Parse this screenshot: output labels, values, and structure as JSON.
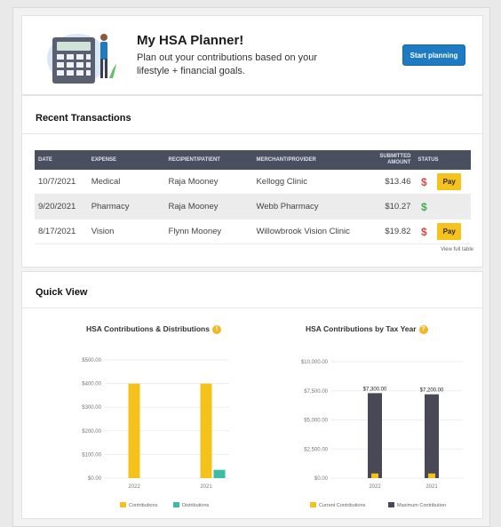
{
  "planner": {
    "title": "My HSA Planner!",
    "description": "Plan out your contributions based on your lifestyle + financial goals.",
    "button_label": "Start planning"
  },
  "transactions": {
    "title": "Recent Transactions",
    "columns": [
      "DATE",
      "EXPENSE",
      "RECIPIENT/PATIENT",
      "MERCHANT/PROVIDER",
      "SUBMITTED AMOUNT",
      "STATUS"
    ],
    "rows": [
      {
        "date": "10/7/2021",
        "expense": "Medical",
        "recipient": "Raja Mooney",
        "merchant": "Kellogg Clinic",
        "amount": "$13.46",
        "status": "$",
        "status_color": "#e04646",
        "action": "Pay"
      },
      {
        "date": "9/20/2021",
        "expense": "Pharmacy",
        "recipient": "Raja Mooney",
        "merchant": "Webb Pharmacy",
        "amount": "$10.27",
        "status": "$",
        "status_color": "#3bb04a",
        "action": ""
      },
      {
        "date": "8/17/2021",
        "expense": "Vision",
        "recipient": "Flynn Mooney",
        "merchant": "Willowbrook Vision Clinic",
        "amount": "$19.82",
        "status": "$",
        "status_color": "#e04646",
        "action": "Pay"
      }
    ],
    "view_full_label": "View full table"
  },
  "quick_view": {
    "title": "Quick View"
  },
  "colors": {
    "contributions": "#f5c21b",
    "distributions": "#3cbca3",
    "maximum": "#474a56",
    "pay_button": "#f6c21c",
    "primary_button": "#1f7bc1"
  },
  "chart_data": [
    {
      "type": "bar",
      "title": "HSA Contributions & Distributions",
      "categories": [
        "2022",
        "2021"
      ],
      "series": [
        {
          "name": "Contributions",
          "values": [
            400,
            400
          ]
        },
        {
          "name": "Distributions",
          "values": [
            0,
            35
          ]
        }
      ],
      "ylim": [
        0,
        500
      ],
      "yticks": [
        "$0.00",
        "$100.00",
        "$200.00",
        "$300.00",
        "$400.00",
        "$500.00"
      ],
      "grid": true,
      "legend": "bottom"
    },
    {
      "type": "bar",
      "title": "HSA Contributions by Tax Year",
      "categories": [
        "2022",
        "2021"
      ],
      "series": [
        {
          "name": "Current Contributions",
          "values": [
            400,
            400
          ]
        },
        {
          "name": "Maximum Contribution",
          "values": [
            7300,
            7200
          ]
        }
      ],
      "data_labels": [
        "$7,300.00",
        "$7,200.00"
      ],
      "ylim": [
        0,
        10000
      ],
      "yticks": [
        "$0.00",
        "$2,500.00",
        "$5,000.00",
        "$7,500.00",
        "$10,000.00"
      ],
      "grid": true,
      "legend": "bottom"
    }
  ]
}
